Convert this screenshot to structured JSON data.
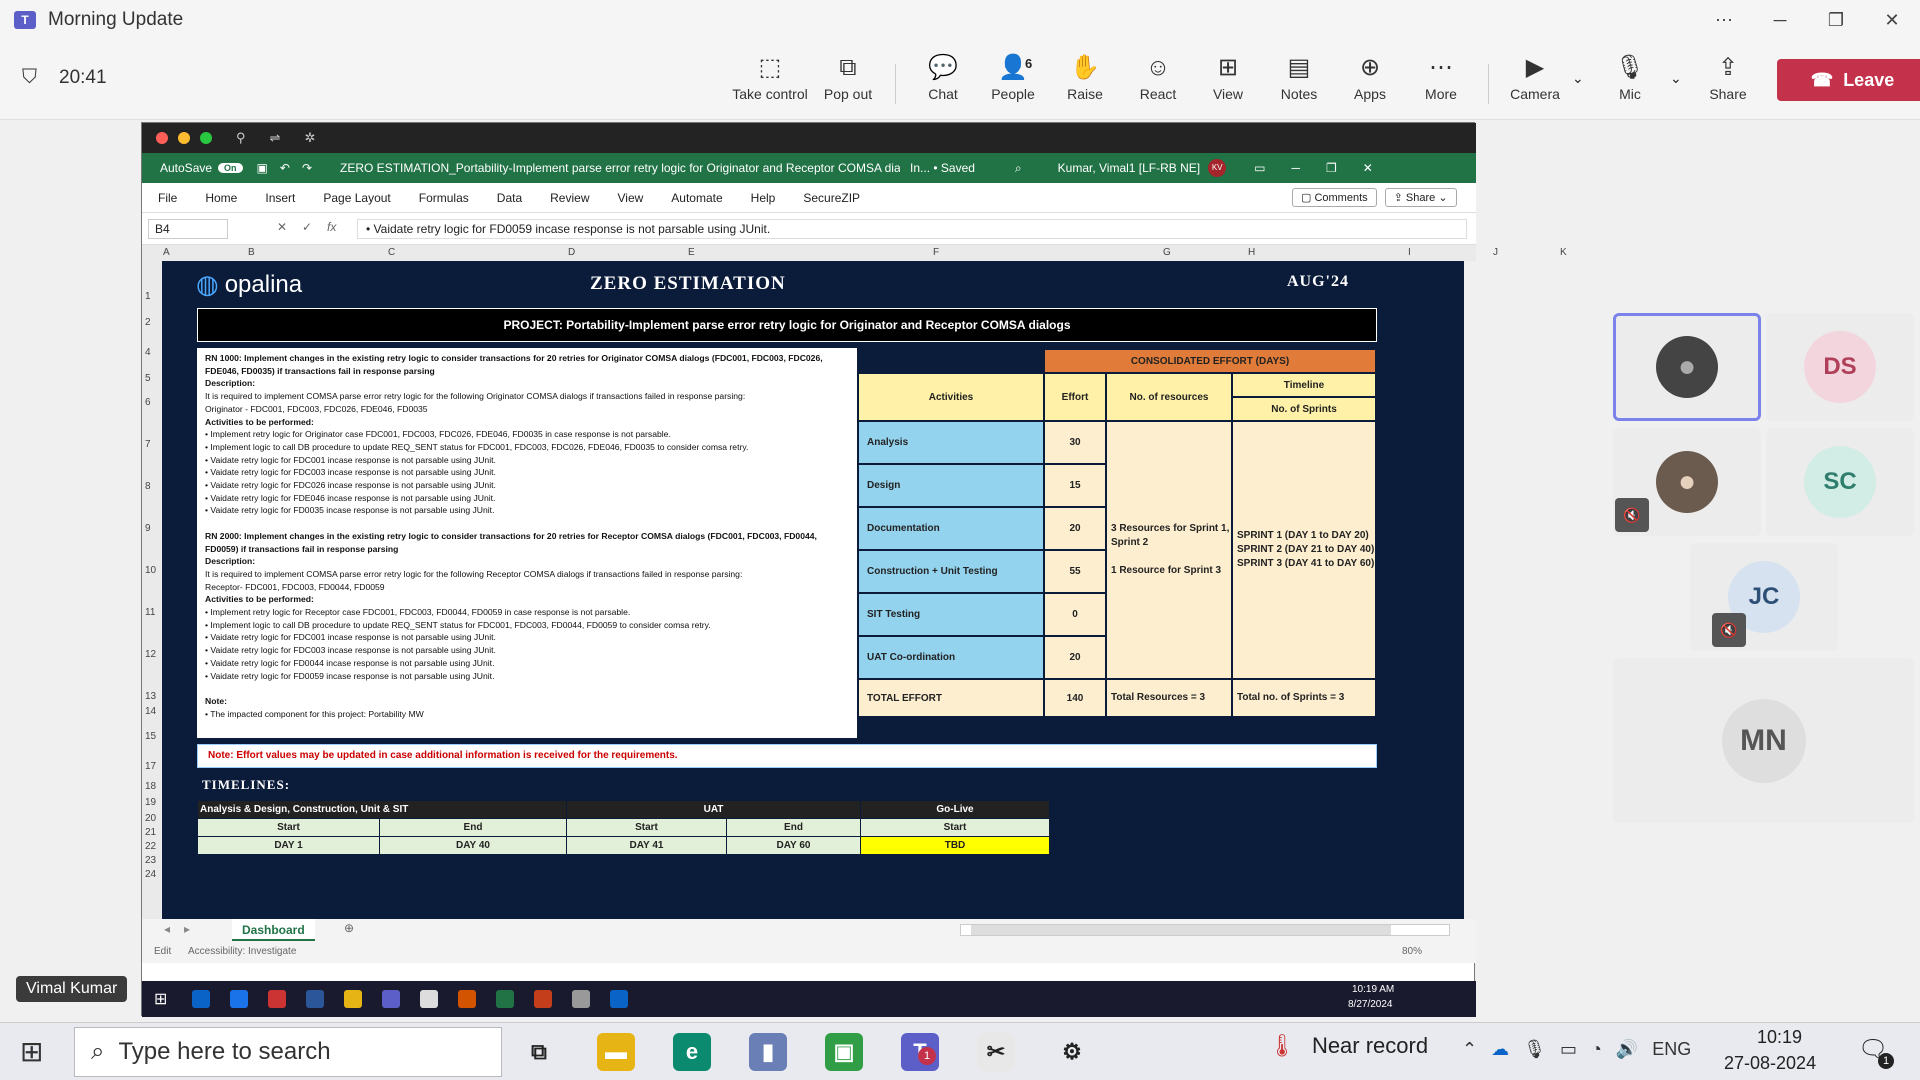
{
  "teams": {
    "title": "Morning Update",
    "timer": "20:41",
    "buttons": [
      {
        "label": "Take control",
        "icon": "take-control-icon",
        "glyph": "⬚"
      },
      {
        "label": "Pop out",
        "icon": "pop-out-icon",
        "glyph": "⧉"
      },
      {
        "label": "Chat",
        "icon": "chat-icon",
        "glyph": "💬"
      },
      {
        "label": "People",
        "icon": "people-icon",
        "glyph": "👤",
        "badge": "6"
      },
      {
        "label": "Raise",
        "icon": "raise-hand-icon",
        "glyph": "✋"
      },
      {
        "label": "React",
        "icon": "react-icon",
        "glyph": "☺"
      },
      {
        "label": "View",
        "icon": "view-icon",
        "glyph": "⊞"
      },
      {
        "label": "Notes",
        "icon": "notes-icon",
        "glyph": "▤"
      },
      {
        "label": "Apps",
        "icon": "apps-icon",
        "glyph": "⊕"
      },
      {
        "label": "More",
        "icon": "more-icon",
        "glyph": "⋯"
      },
      {
        "label": "Camera",
        "icon": "camera-off-icon",
        "glyph": "▶"
      },
      {
        "label": "Mic",
        "icon": "mic-icon",
        "glyph": "🎙"
      },
      {
        "label": "Share",
        "icon": "share-icon",
        "glyph": "⇪"
      }
    ],
    "leave": "Leave",
    "presenter": "Vimal Kumar",
    "participants": [
      {
        "initials": "",
        "kind": "photo"
      },
      {
        "initials": "DS",
        "color": "#b0405a"
      },
      {
        "initials": "",
        "kind": "photo2"
      },
      {
        "initials": "SC",
        "color": "#2f7d6d"
      },
      {
        "initials": "JC",
        "color": "#2e4f76"
      },
      {
        "initials": "MN",
        "color": "#555555"
      }
    ]
  },
  "excel": {
    "autosave": "AutoSave",
    "autosave_state": "On",
    "file_title": "ZERO ESTIMATION_Portability-Implement parse error retry logic for Originator and Receptor COMSA dialogs_Agi...",
    "saved": "In... • Saved",
    "user": "Kumar, Vimal1 [LF-RB NE]",
    "user_initials": "KV",
    "menu": [
      "File",
      "Home",
      "Insert",
      "Page Layout",
      "Formulas",
      "Data",
      "Review",
      "View",
      "Automate",
      "Help",
      "SecureZIP"
    ],
    "comments": "Comments",
    "share": "Share",
    "cell_ref": "B4",
    "formula": "• Vaidate retry logic for FD0059 incase response is not parsable using JUnit.",
    "columns": [
      "A",
      "B",
      "C",
      "D",
      "E",
      "F",
      "G",
      "H",
      "I",
      "J",
      "K"
    ],
    "rows": [
      "1",
      "2",
      "4",
      "5",
      "6",
      "7",
      "8",
      "9",
      "10",
      "11",
      "12",
      "13",
      "14",
      "15",
      "17",
      "18",
      "19",
      "20",
      "21",
      "22",
      "23",
      "24"
    ],
    "sheet_tab": "Dashboard",
    "status_left": "Edit",
    "accessibility": "Accessibility: Investigate",
    "zoom": "80%",
    "clock_time": "10:19 AM",
    "clock_date": "8/27/2024"
  },
  "sheet": {
    "logo": "opalina",
    "title": "ZERO ESTIMATION",
    "period": "AUG'24",
    "project": "PROJECT: Portability-Implement parse error retry logic for Originator and Receptor COMSA dialogs",
    "req_lines": [
      {
        "t": "RN 1000: Implement changes in the existing retry logic to consider transactions for 20 retries for Originator COMSA dialogs (FDC001, FDC003, FDC026,",
        "b": true
      },
      {
        "t": "FDE046, FD0035) if transactions fail in response parsing",
        "b": true
      },
      {
        "t": "Description:",
        "b": true
      },
      {
        "t": "It is required to implement COMSA parse error retry logic for the following Originator COMSA dialogs if transactions failed in response parsing:",
        "b": false
      },
      {
        "t": "Originator - FDC001, FDC003, FDC026, FDE046, FD0035",
        "b": false
      },
      {
        "t": "Activities to be performed:",
        "b": true
      },
      {
        "t": "• Implement retry logic for Originator case FDC001, FDC003, FDC026, FDE046, FD0035 in case response is not parsable.",
        "b": false
      },
      {
        "t": "• Implement logic to call DB procedure to update REQ_SENT status for FDC001, FDC003, FDC026, FDE046, FD0035 to consider comsa retry.",
        "b": false
      },
      {
        "t": "• Vaidate retry logic for FDC001 incase response is not parsable using JUnit.",
        "b": false
      },
      {
        "t": "• Vaidate retry logic for FDC003 incase response is not parsable using JUnit.",
        "b": false
      },
      {
        "t": "• Vaidate retry logic for FDC026 incase response is not parsable using JUnit.",
        "b": false
      },
      {
        "t": "• Vaidate retry logic for FDE046 incase response is not parsable using JUnit.",
        "b": false
      },
      {
        "t": "• Vaidate retry logic for FD0035 incase response is not parsable using JUnit.",
        "b": false
      },
      {
        "t": "",
        "b": false
      },
      {
        "t": "RN 2000: Implement changes in the existing retry logic to consider transactions for 20 retries for Receptor COMSA dialogs (FDC001, FDC003, FD0044,",
        "b": true
      },
      {
        "t": "FD0059) if transactions fail in response parsing",
        "b": true
      },
      {
        "t": "Description:",
        "b": true
      },
      {
        "t": "It is required to implement COMSA parse error retry logic for the following Receptor COMSA dialogs if transactions failed in response parsing:",
        "b": false
      },
      {
        "t": "Receptor- FDC001, FDC003, FD0044, FD0059",
        "b": false
      },
      {
        "t": "Activities to be performed:",
        "b": true
      },
      {
        "t": "• Implement retry logic for Receptor case FDC001, FDC003, FD0044, FD0059 in case response is not parsable.",
        "b": false
      },
      {
        "t": "• Implement logic to call DB procedure to update REQ_SENT status for FDC001, FDC003, FD0044, FD0059 to consider comsa retry.",
        "b": false
      },
      {
        "t": "• Vaidate retry logic for FDC001 incase response is not parsable using JUnit.",
        "b": false
      },
      {
        "t": "• Vaidate retry logic for FDC003 incase response is not parsable using JUnit.",
        "b": false
      },
      {
        "t": "• Vaidate retry logic for FD0044 incase response is not parsable using JUnit.",
        "b": false
      },
      {
        "t": "• Vaidate retry logic for FD0059 incase response is not parsable using JUnit.",
        "b": false
      },
      {
        "t": "",
        "b": false
      },
      {
        "t": "Note:",
        "b": true
      },
      {
        "t": "•            The impacted component for this project: Portability MW",
        "b": false
      }
    ],
    "effort_header": "CONSOLIDATED EFFORT (DAYS)",
    "col_activities": "Activities",
    "col_effort": "Effort",
    "col_resources": "No. of resources",
    "col_timeline": "Timeline",
    "col_sprints": "No. of Sprints",
    "activities": [
      {
        "name": "Analysis",
        "effort": "30"
      },
      {
        "name": "Design",
        "effort": "15"
      },
      {
        "name": "Documentation",
        "effort": "20"
      },
      {
        "name": "Construction + Unit Testing",
        "effort": "55"
      },
      {
        "name": "SIT Testing",
        "effort": "0"
      },
      {
        "name": "UAT Co-ordination",
        "effort": "20"
      }
    ],
    "resources_text1": "3 Resources for Sprint 1, Sprint 2",
    "resources_text2": "1 Resource for Sprint 3",
    "sprints": [
      "SPRINT 1 (DAY 1 to DAY 20)",
      "SPRINT 2 (DAY 21 to DAY 40)",
      "SPRINT 3 (DAY 41 to DAY 60)"
    ],
    "total_label": "TOTAL EFFORT",
    "total_value": "140",
    "total_resources": "Total Resources = 3",
    "total_sprints": "Total no. of Sprints = 3",
    "note": "Note: Effort values may be updated in case additional information is received for the requirements.",
    "timelines": "TIMELINES:",
    "tl_phase1": "Analysis & Design, Construction, Unit & SIT",
    "tl_phase2": "UAT",
    "tl_phase3": "Go-Live",
    "tl_start": "Start",
    "tl_end": "End",
    "tl_d1": "DAY 1",
    "tl_d40": "DAY 40",
    "tl_d41": "DAY 41",
    "tl_d60": "DAY 60",
    "tl_tbd": "TBD"
  },
  "windows": {
    "search": "Type here to search",
    "weather": "Near record",
    "lang": "ENG",
    "time": "10:19",
    "date": "27-08-2024",
    "notif": "1",
    "teams_badge": "1"
  }
}
